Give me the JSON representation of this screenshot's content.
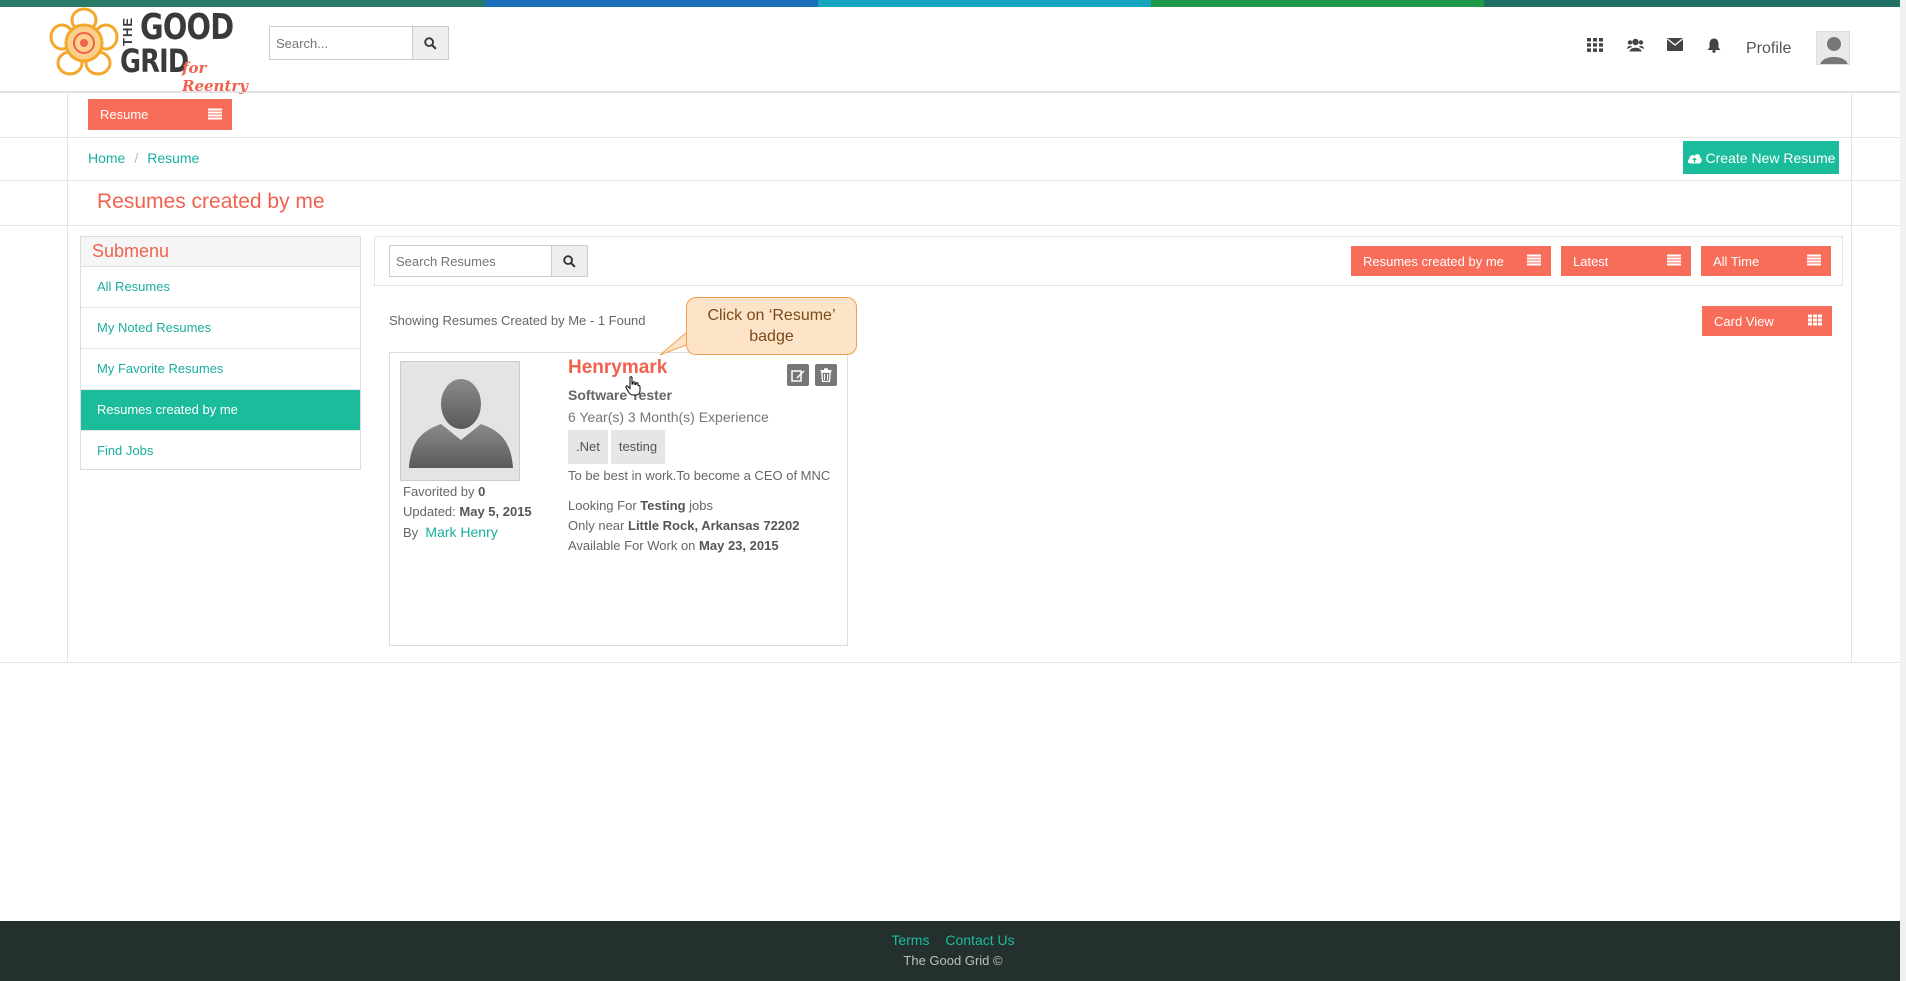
{
  "colors": {
    "accent_coral": "#f86c5a",
    "accent_teal": "#1bbc9b",
    "footer_bg": "#24302e",
    "stripe": [
      "#2a7a6a",
      "#1a6fb8",
      "#1690d8",
      "#17a5c0",
      "#1e9a4a",
      "#206f64"
    ]
  },
  "header": {
    "logo": {
      "the": "THE",
      "good": "GOOD",
      "grid": "GRID",
      "tagline": "for Reentry"
    },
    "search_placeholder": "Search...",
    "nav_icons": [
      "apps-grid-icon",
      "users-icon",
      "envelope-icon",
      "bell-icon"
    ],
    "profile_label": "Profile"
  },
  "section_menu": {
    "label": "Resume"
  },
  "breadcrumb": {
    "items": [
      "Home",
      "Resume"
    ]
  },
  "create_button": {
    "label": "Create New Resume"
  },
  "page_title": "Resumes created by me",
  "submenu": {
    "title": "Submenu",
    "items": [
      {
        "label": "All Resumes",
        "active": false
      },
      {
        "label": "My Noted Resumes",
        "active": false
      },
      {
        "label": "My Favorite Resumes",
        "active": false
      },
      {
        "label": "Resumes created by me",
        "active": true
      },
      {
        "label": "Find Jobs",
        "active": false
      }
    ]
  },
  "filters": {
    "search_placeholder": "Search Resumes",
    "owner": "Resumes created by me",
    "sort": "Latest",
    "time": "All Time",
    "view": "Card View"
  },
  "results_summary": "Showing Resumes Created by Me - 1 Found",
  "callout": {
    "text": "Click on ‘Resume’ badge"
  },
  "resume_card": {
    "name": "Henrymark",
    "role": "Software Tester",
    "experience": "6 Year(s) 3 Month(s) Experience",
    "skills": [
      ".Net",
      "testing"
    ],
    "objective": "To be best in work.To become a CEO of MNC",
    "favorited_label": "Favorited by",
    "favorited_count": "0",
    "updated_label": "Updated:",
    "updated_date": "May 5, 2015",
    "by_label": "By",
    "author": "Mark Henry",
    "looking_for_prefix": "Looking For",
    "looking_for_value": "Testing",
    "looking_for_suffix": "jobs",
    "near_prefix": "Only near",
    "near_value": "Little Rock, Arkansas 72202",
    "available_prefix": "Available For Work on",
    "available_value": "May 23, 2015"
  },
  "footer": {
    "links": [
      "Terms",
      "Contact Us"
    ],
    "copyright": "The Good Grid ©"
  }
}
